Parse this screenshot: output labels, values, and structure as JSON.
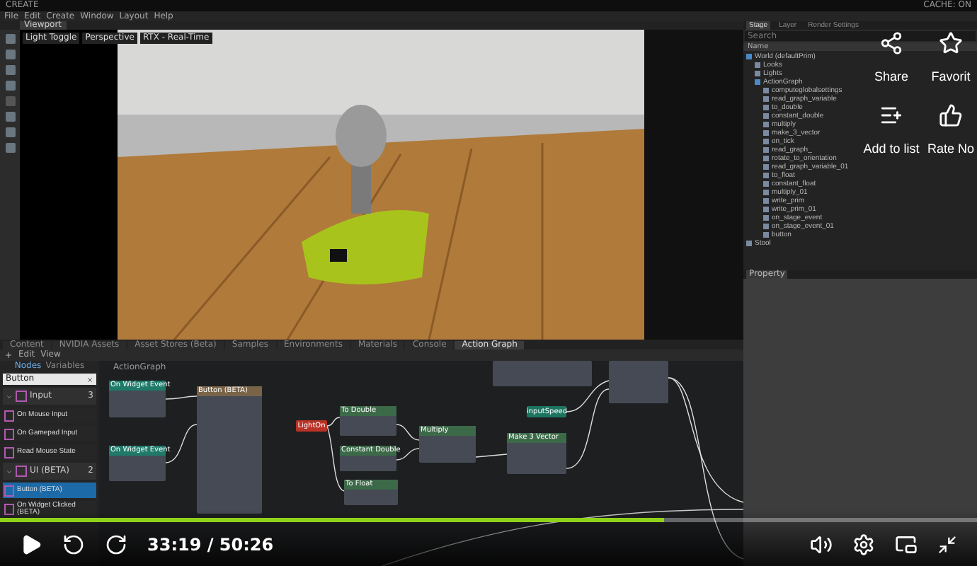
{
  "app": {
    "title": "CREATE",
    "menu": [
      "File",
      "Edit",
      "Create",
      "Window",
      "Layout",
      "Help"
    ],
    "cache": "CACHE: ON"
  },
  "viewport": {
    "tab": "Viewport",
    "buttons": [
      "Light Toggle",
      "Perspective",
      "RTX - Real-Time"
    ]
  },
  "stage": {
    "tabs": [
      {
        "label": "Stage",
        "selected": true
      },
      {
        "label": "Layer",
        "selected": false
      },
      {
        "label": "Render Settings",
        "selected": false
      }
    ],
    "search_placeholder": "Search",
    "column": "Name",
    "tree": [
      {
        "name": "World (defaultPrim)",
        "children": [
          {
            "name": "Looks"
          },
          {
            "name": "Lights"
          },
          {
            "name": "ActionGraph",
            "children": [
              {
                "name": "computeglobalsettings"
              },
              {
                "name": "read_graph_variable"
              },
              {
                "name": "to_double"
              },
              {
                "name": "constant_double"
              },
              {
                "name": "multiply"
              },
              {
                "name": "make_3_vector"
              },
              {
                "name": "on_tick"
              },
              {
                "name": "read_graph_"
              },
              {
                "name": "rotate_to_orientation"
              },
              {
                "name": "read_graph_variable_01"
              },
              {
                "name": "to_float"
              },
              {
                "name": "constant_float"
              },
              {
                "name": "multiply_01"
              },
              {
                "name": "write_prim"
              },
              {
                "name": "write_prim_01"
              },
              {
                "name": "on_stage_event"
              },
              {
                "name": "on_stage_event_01"
              },
              {
                "name": "button"
              }
            ]
          }
        ]
      },
      {
        "name": "Stool"
      }
    ],
    "property_tab": "Property"
  },
  "bottom": {
    "tabs": [
      {
        "label": "Content",
        "selected": false
      },
      {
        "label": "NVIDIA Assets",
        "selected": false
      },
      {
        "label": "Asset Stores (Beta)",
        "selected": false
      },
      {
        "label": "Samples",
        "selected": false
      },
      {
        "label": "Environments",
        "selected": false
      },
      {
        "label": "Materials",
        "selected": false
      },
      {
        "label": "Console",
        "selected": false
      },
      {
        "label": "Action Graph",
        "selected": true
      }
    ],
    "toolbar": [
      "Edit",
      "View"
    ],
    "library": {
      "tabs": [
        {
          "label": "Nodes",
          "selected": true
        },
        {
          "label": "Variables",
          "selected": false
        }
      ],
      "search": "Button",
      "categories": [
        {
          "name": "Input",
          "count": "3",
          "items": [
            {
              "name": "On Mouse Input",
              "selected": false
            },
            {
              "name": "On Gamepad Input",
              "selected": false
            },
            {
              "name": "Read Mouse State",
              "selected": false
            }
          ]
        },
        {
          "name": "UI (BETA)",
          "count": "2",
          "items": [
            {
              "name": "Button (BETA)",
              "selected": true
            },
            {
              "name": "On Widget Clicked (BETA)",
              "selected": false
            }
          ]
        }
      ]
    },
    "graph": {
      "title": "ActionGraph",
      "nodes": [
        {
          "kind": "node",
          "title": "On Widget Event",
          "color": "#1f7a6a"
        },
        {
          "kind": "node",
          "title": "On Widget Event",
          "color": "#1f7a6a"
        },
        {
          "kind": "node",
          "title": "Button (BETA)",
          "color": "#7a6448"
        },
        {
          "kind": "pill",
          "title": "LightOn",
          "color": "#b83226"
        },
        {
          "kind": "node",
          "title": "To Double",
          "color": "#3c6a48"
        },
        {
          "kind": "node",
          "title": "Constant Double",
          "color": "#3c6a48"
        },
        {
          "kind": "node",
          "title": "To Float",
          "color": "#3c6a48"
        },
        {
          "kind": "node",
          "title": "Multiply",
          "color": "#3c6a48"
        },
        {
          "kind": "pill",
          "title": "inputSpeed",
          "color": "#1c7560"
        },
        {
          "kind": "node",
          "title": "Make 3 Vector",
          "color": "#3c6a48"
        }
      ]
    }
  },
  "video": {
    "actions": [
      {
        "kind": "share",
        "label": "Share"
      },
      {
        "kind": "favorite",
        "label": "Favorit"
      },
      {
        "kind": "add",
        "label": "Add to list"
      },
      {
        "kind": "rate",
        "label": "Rate No"
      }
    ],
    "progress": {
      "level": 0.68
    },
    "time": "33:19 / 50:26"
  }
}
